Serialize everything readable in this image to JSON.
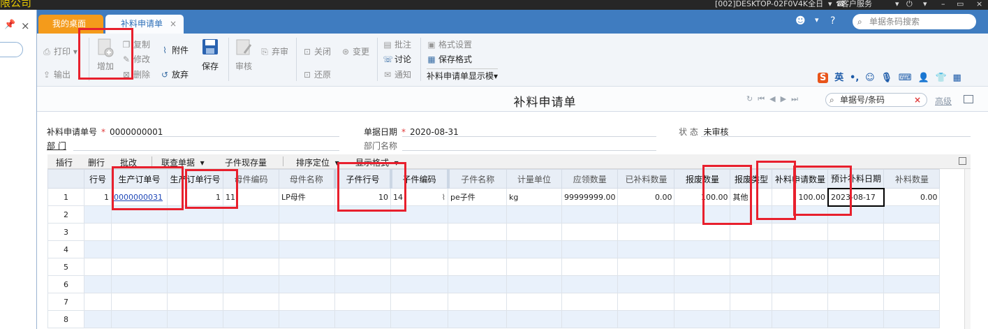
{
  "topbar": {
    "company": "限公司",
    "machine": "[002]DESKTOP-02F0V4K全日",
    "service": "客户服务"
  },
  "left_panel": {
    "pin": "▼",
    "close": "×"
  },
  "tabs": [
    {
      "label": "我的桌面"
    },
    {
      "label": "补料申请单"
    }
  ],
  "tab_close": "×",
  "barcode_search": {
    "placeholder": "单据条码搜索"
  },
  "toolbar": {
    "print": "打印",
    "output": "输出",
    "add": "增加",
    "copy": "复制",
    "modify": "修改",
    "delete": "删除",
    "attach": "附件",
    "abandon": "放弃",
    "save": "保存",
    "review": "审核",
    "unreview": "弃审",
    "close": "关闭",
    "change": "变更",
    "restore": "还原",
    "comment": "批注",
    "discuss": "讨论",
    "notify": "通知",
    "format_settings": "格式设置",
    "save_format": "保存格式",
    "display_template": "补料申请单显示模"
  },
  "ime": {
    "logo": "S",
    "lang": "英"
  },
  "form": {
    "title": "补料申请单",
    "bill_search": "单据号/条码",
    "advanced": "高级",
    "fields": {
      "bill_no_label": "补料申请单号",
      "bill_no": "0000000001",
      "date_label": "单据日期",
      "date": "2020-08-31",
      "status_label": "状  态",
      "status": "未审核",
      "dept_label": "部  门",
      "dept_name_label": "部门名称"
    }
  },
  "subbar": {
    "insert_row": "插行",
    "delete_row": "删行",
    "batch_modify": "批改",
    "linked_query": "联查单据",
    "stock": "子件现存量",
    "sort_locate": "排序定位",
    "display_format": "显示格式"
  },
  "table": {
    "headers": [
      "行号",
      "生产订单号",
      "生产订单行号",
      "母件编码",
      "母件名称",
      "子件行号",
      "子件编码",
      "子件名称",
      "计量单位",
      "应领数量",
      "已补料数量",
      "报废数量",
      "报废类型",
      "补料申请数量",
      "预计补料日期",
      "补料数量"
    ],
    "row": {
      "row_no": "1",
      "order_no": "0000000031",
      "order_line": "1",
      "parent_code": "11",
      "parent_name": "LP母件",
      "child_line": "10",
      "child_code": "14",
      "child_name": "pe子件",
      "unit": "kg",
      "required_qty": "99999999.00",
      "supplied_qty": "0.00",
      "scrap_qty": "100.00",
      "scrap_type": "其他",
      "apply_qty": "100.00",
      "expected_date": "2023-08-17",
      "supply_qty": "0.00"
    },
    "row_numbers": [
      "1",
      "2",
      "3",
      "4",
      "5",
      "6",
      "7",
      "8"
    ]
  }
}
